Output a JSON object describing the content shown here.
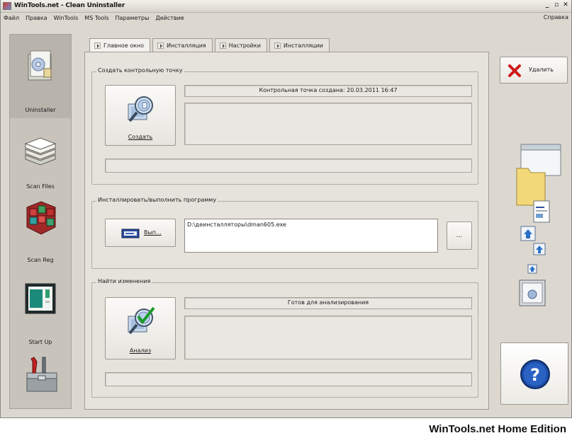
{
  "window": {
    "title": "WinTools.net - Clean Uninstaller"
  },
  "menu": {
    "items": [
      "Файл",
      "Правка",
      "WinTools",
      "MS Tools",
      "Параметры",
      "Действие"
    ],
    "help": "Справка"
  },
  "sidebar": {
    "items": [
      {
        "label": "Uninstaller",
        "icon": "uninstaller-icon",
        "active": true
      },
      {
        "label": "Scan Files",
        "icon": "scan-files-icon"
      },
      {
        "label": "Scan Reg",
        "icon": "scan-reg-icon"
      },
      {
        "label": "Start Up",
        "icon": "startup-icon"
      },
      {
        "label": "",
        "icon": "toolbox-icon"
      }
    ]
  },
  "tabs": [
    {
      "label": "Главное окно",
      "active": true
    },
    {
      "label": "Инсталляция"
    },
    {
      "label": "Настройки"
    },
    {
      "label": "Инсталляции"
    }
  ],
  "restore_point": {
    "group_title": "Создать контрольную точку",
    "button_label": "Создать",
    "status": "Контрольная точка создана:  20.03.2011 16:47"
  },
  "install": {
    "group_title": "Инсталлировать/выполнить программу",
    "run_label": "Вып...",
    "path": "D:\\деинсталляторы\\dman605.exe",
    "browse_label": "..."
  },
  "changes": {
    "group_title": "Найти изменения",
    "button_label": "Анализ",
    "status": "Готов для анализирования"
  },
  "right": {
    "delete_label": "Удалить"
  },
  "footer": {
    "edition": "WinTools.net Home Edition"
  }
}
